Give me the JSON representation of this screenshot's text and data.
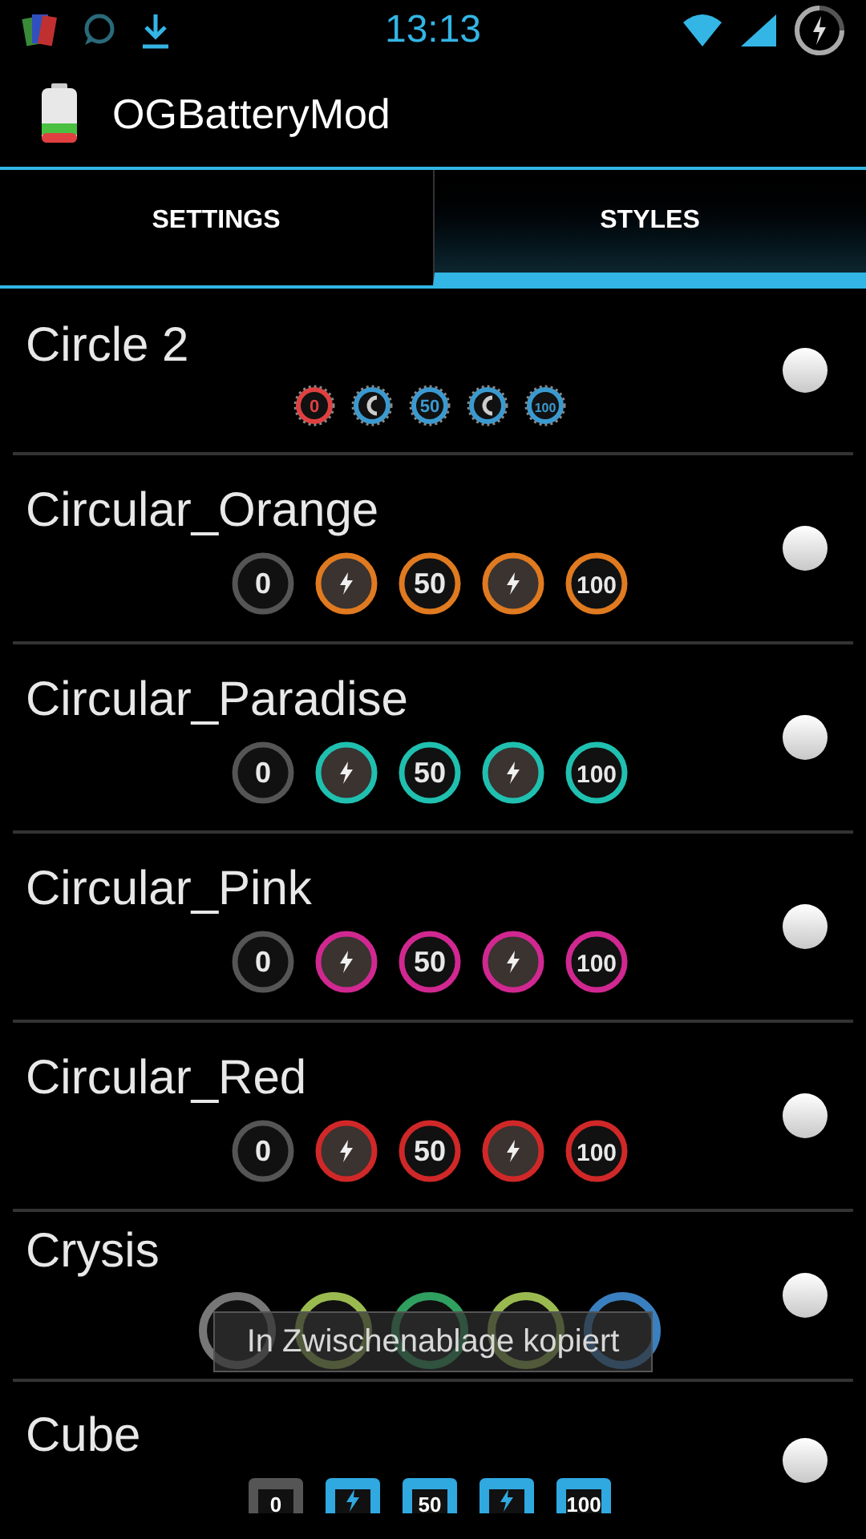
{
  "status_bar": {
    "time": "13:13"
  },
  "action_bar": {
    "title": "OGBatteryMod"
  },
  "tabs": [
    {
      "label": "SETTINGS",
      "selected": false
    },
    {
      "label": "STYLES",
      "selected": true
    }
  ],
  "styles": [
    {
      "name": "Circle 2",
      "kind": "gear",
      "selected": false,
      "icons": [
        {
          "kind": "number",
          "label": "0",
          "color": "#e04040"
        },
        {
          "kind": "plug",
          "color": "#3a9ad0"
        },
        {
          "kind": "number",
          "label": "50",
          "color": "#3a9ad0"
        },
        {
          "kind": "plug",
          "color": "#3a9ad0"
        },
        {
          "kind": "number",
          "label": "100",
          "color": "#3a9ad0"
        }
      ]
    },
    {
      "name": "Circular_Orange",
      "kind": "circle",
      "selected": false,
      "icons": [
        {
          "kind": "number",
          "label": "0",
          "color": "#555555"
        },
        {
          "kind": "bolt",
          "color": "#e07a20"
        },
        {
          "kind": "number",
          "label": "50",
          "color": "#e07a20"
        },
        {
          "kind": "bolt",
          "color": "#e07a20"
        },
        {
          "kind": "number",
          "label": "100",
          "color": "#e07a20"
        }
      ]
    },
    {
      "name": "Circular_Paradise",
      "kind": "circle",
      "selected": false,
      "icons": [
        {
          "kind": "number",
          "label": "0",
          "color": "#555555"
        },
        {
          "kind": "bolt",
          "color": "#20c0b0"
        },
        {
          "kind": "number",
          "label": "50",
          "color": "#20c0b0"
        },
        {
          "kind": "bolt",
          "color": "#20c0b0"
        },
        {
          "kind": "number",
          "label": "100",
          "color": "#20c0b0"
        }
      ]
    },
    {
      "name": "Circular_Pink",
      "kind": "circle",
      "selected": false,
      "icons": [
        {
          "kind": "number",
          "label": "0",
          "color": "#555555"
        },
        {
          "kind": "bolt",
          "color": "#d02890"
        },
        {
          "kind": "number",
          "label": "50",
          "color": "#d02890"
        },
        {
          "kind": "bolt",
          "color": "#d02890"
        },
        {
          "kind": "number",
          "label": "100",
          "color": "#d02890"
        }
      ]
    },
    {
      "name": "Circular_Red",
      "kind": "circle",
      "selected": false,
      "icons": [
        {
          "kind": "number",
          "label": "0",
          "color": "#555555"
        },
        {
          "kind": "bolt",
          "color": "#d02828"
        },
        {
          "kind": "number",
          "label": "50",
          "color": "#d02828"
        },
        {
          "kind": "bolt",
          "color": "#d02828"
        },
        {
          "kind": "number",
          "label": "100",
          "color": "#d02828"
        }
      ]
    },
    {
      "name": "Crysis",
      "kind": "crysis",
      "selected": false,
      "icons": [
        {
          "kind": "blank",
          "color": "#777777"
        },
        {
          "kind": "blank",
          "color": "#9aba50"
        },
        {
          "kind": "blank",
          "color": "#30a060"
        },
        {
          "kind": "blank",
          "color": "#9aba50"
        },
        {
          "kind": "blank",
          "color": "#3a80c0"
        }
      ]
    },
    {
      "name": "Cube",
      "kind": "cube",
      "selected": false,
      "icons": [
        {
          "kind": "number",
          "label": "0",
          "color": "#555555"
        },
        {
          "kind": "bolt",
          "color": "#30a8e0"
        },
        {
          "kind": "number",
          "label": "50",
          "color": "#30a8e0"
        },
        {
          "kind": "bolt",
          "color": "#30a8e0"
        },
        {
          "kind": "number",
          "label": "100",
          "color": "#30a8e0"
        }
      ]
    }
  ],
  "toast": {
    "text": "In Zwischenablage kopiert"
  }
}
